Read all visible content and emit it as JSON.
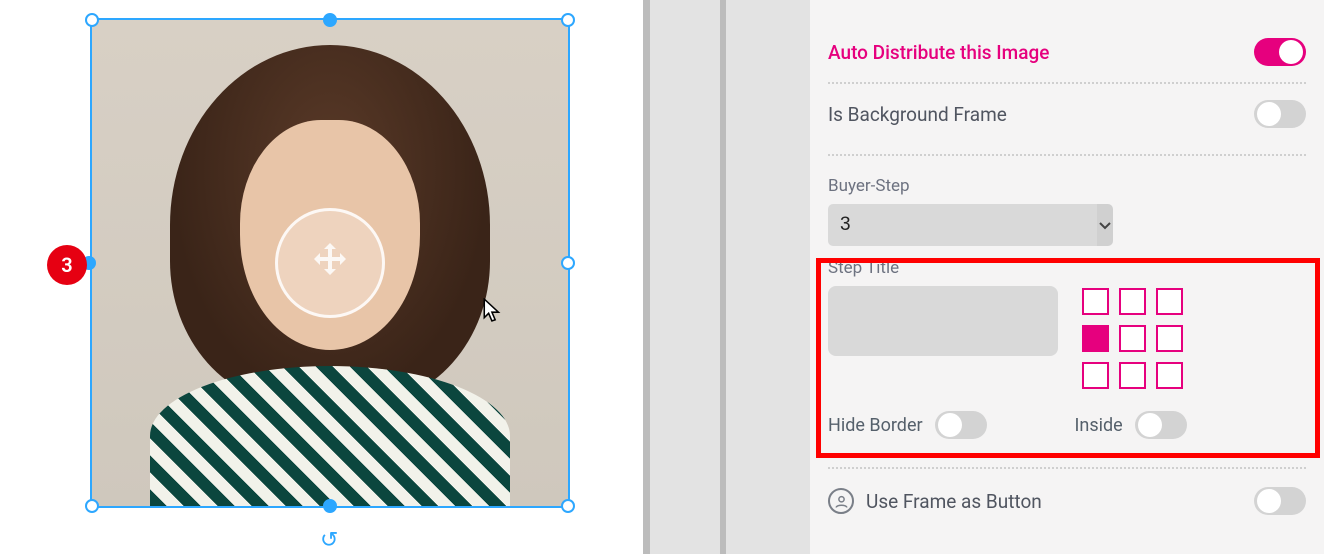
{
  "canvas": {
    "step_badge": "3",
    "move_icon": "move-arrows-icon",
    "cursor_icon": "cursor-arrow-icon",
    "undo_icon": "undo-icon"
  },
  "inspector": {
    "auto_distribute": {
      "label": "Auto Distribute this Image",
      "value": true
    },
    "is_background": {
      "label": "Is Background Frame",
      "value": false
    },
    "buyer_step": {
      "label": "Buyer-Step",
      "value": "3"
    },
    "step_title": {
      "label": "Step Title",
      "value": ""
    },
    "anchor_selected_index": 3,
    "hide_border": {
      "label": "Hide Border",
      "value": false
    },
    "inside": {
      "label": "Inside",
      "value": false
    },
    "use_frame_btn": {
      "label": "Use Frame as Button",
      "value": false
    }
  },
  "colors": {
    "accent": "#e6007e",
    "selection": "#2da7ff",
    "badge": "#e60012",
    "highlight": "#ff0000"
  }
}
